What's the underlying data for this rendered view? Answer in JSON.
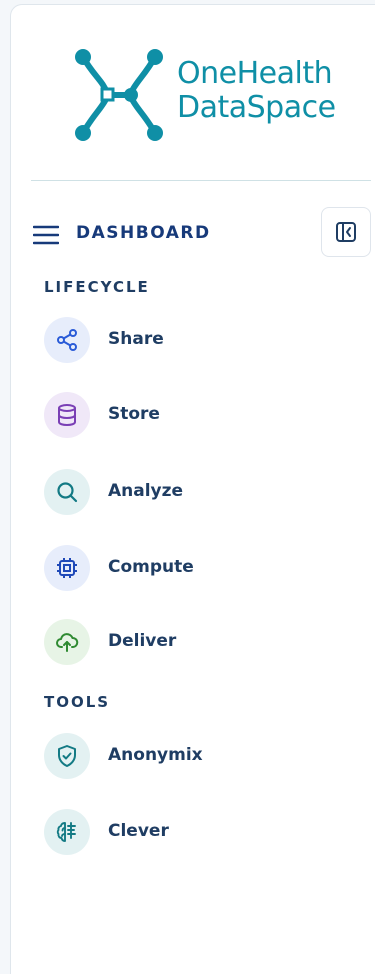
{
  "brand": {
    "line1": "OneHealth",
    "line2": "DataSpace",
    "color": "#0f8fa6"
  },
  "header": {
    "menu_icon": "hamburger-icon",
    "title": "DASHBOARD",
    "collapse_icon": "sidebar-collapse-icon"
  },
  "sections": {
    "lifecycle": {
      "title": "LIFECYCLE",
      "items": [
        {
          "label": "Share",
          "icon": "share-icon",
          "color": "#2a5bd7",
          "bg": "#e7edfb"
        },
        {
          "label": "Store",
          "icon": "database-icon",
          "color": "#7a3fb5",
          "bg": "#f0e8f8"
        },
        {
          "label": "Analyze",
          "icon": "search-icon",
          "color": "#137a84",
          "bg": "#e3f1f2"
        },
        {
          "label": "Compute",
          "icon": "cpu-chip-icon",
          "color": "#1f49b8",
          "bg": "#e7edfb"
        },
        {
          "label": "Deliver",
          "icon": "cloud-upload-icon",
          "color": "#2f8a32",
          "bg": "#e7f4e6"
        }
      ]
    },
    "tools": {
      "title": "TOOLS",
      "items": [
        {
          "label": "Anonymix",
          "icon": "shield-check-icon",
          "color": "#137a84",
          "bg": "#e3f1f2"
        },
        {
          "label": "Clever",
          "icon": "brain-icon",
          "color": "#137a84",
          "bg": "#e3f1f2"
        }
      ]
    }
  }
}
